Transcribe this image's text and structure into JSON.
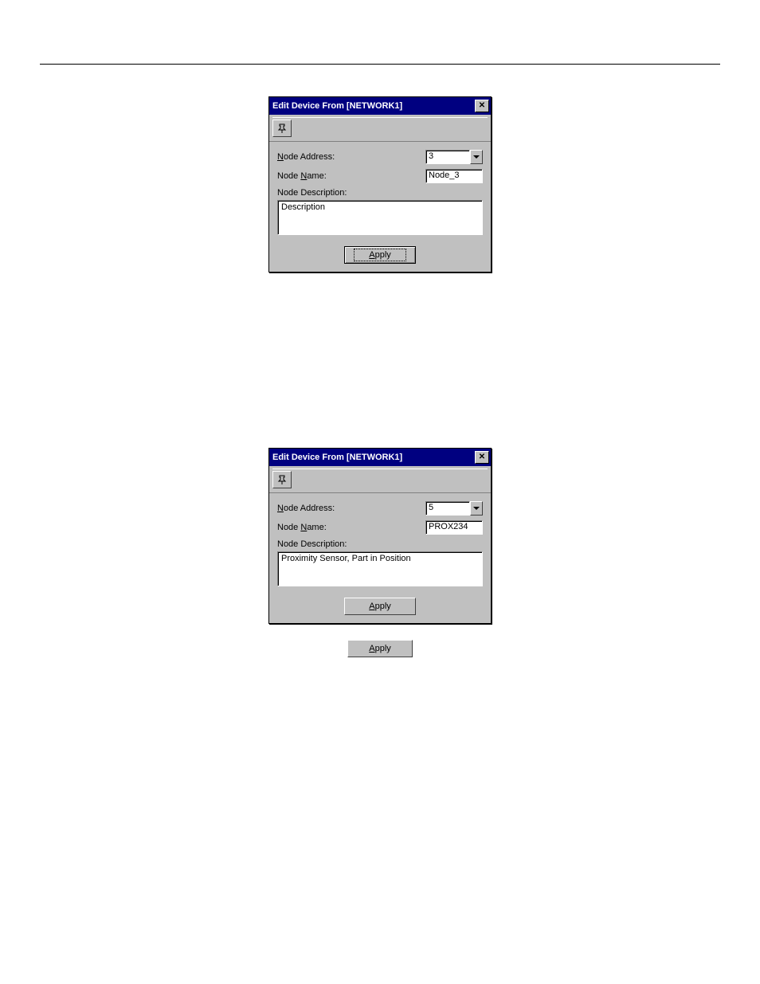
{
  "dialog1": {
    "title": "Edit Device From [NETWORK1]",
    "labels": {
      "node_address_pre": "N",
      "node_address_post": "ode Address:",
      "node_name_pre": "Node ",
      "node_name_u": "N",
      "node_name_post": "ame:",
      "node_desc_pre": "Node ",
      "node_desc_u": "D",
      "node_desc_post": "escription:"
    },
    "values": {
      "node_address": "3",
      "node_name": "Node_3",
      "description": "Description"
    },
    "apply_u": "A",
    "apply_rest": "pply"
  },
  "dialog2": {
    "title": "Edit Device From [NETWORK1]",
    "labels": {
      "node_address_pre": "N",
      "node_address_post": "ode Address:",
      "node_name_pre": "Node ",
      "node_name_u": "N",
      "node_name_post": "ame:",
      "node_desc_pre": "Node ",
      "node_desc_u": "D",
      "node_desc_post": "escription:"
    },
    "values": {
      "node_address": "5",
      "node_name": "PROX234",
      "description": "Proximity Sensor, Part in Position"
    },
    "apply_u": "A",
    "apply_rest": "pply"
  },
  "standalone_apply": {
    "u": "A",
    "rest": "pply"
  }
}
